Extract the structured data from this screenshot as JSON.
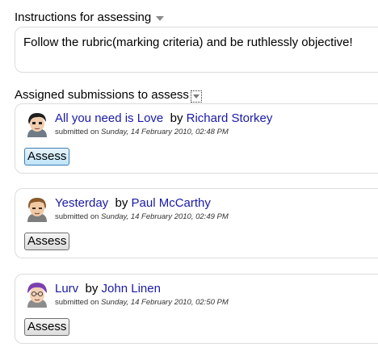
{
  "instructions": {
    "heading": "Instructions for assessing",
    "text": "Follow the rubric(marking criteria) and be ruthlessly objective!"
  },
  "assigned": {
    "heading": "Assigned submissions to assess",
    "submissions": [
      {
        "title": "All you need is Love",
        "by": "by",
        "author": "Richard Storkey",
        "submitted_prefix": "submitted on",
        "date": "Sunday, 14 February 2010, 02:48 PM",
        "button_label": "Assess",
        "avatar_icon": "user-avatar-dark-hair-icon"
      },
      {
        "title": "Yesterday",
        "by": "by",
        "author": "Paul McCarthy",
        "submitted_prefix": "submitted on",
        "date": "Sunday, 14 February 2010, 02:49 PM",
        "button_label": "Assess",
        "avatar_icon": "user-avatar-brown-hair-icon"
      },
      {
        "title": "Lurv",
        "by": "by",
        "author": "John Linen",
        "submitted_prefix": "submitted on",
        "date": "Sunday, 14 February 2010, 02:50 PM",
        "button_label": "Assess",
        "avatar_icon": "user-avatar-purple-hair-icon"
      }
    ]
  },
  "colors": {
    "link": "#1a1aa6",
    "box_border": "#dcdcdc",
    "focused_button": "#bfe4f8"
  }
}
